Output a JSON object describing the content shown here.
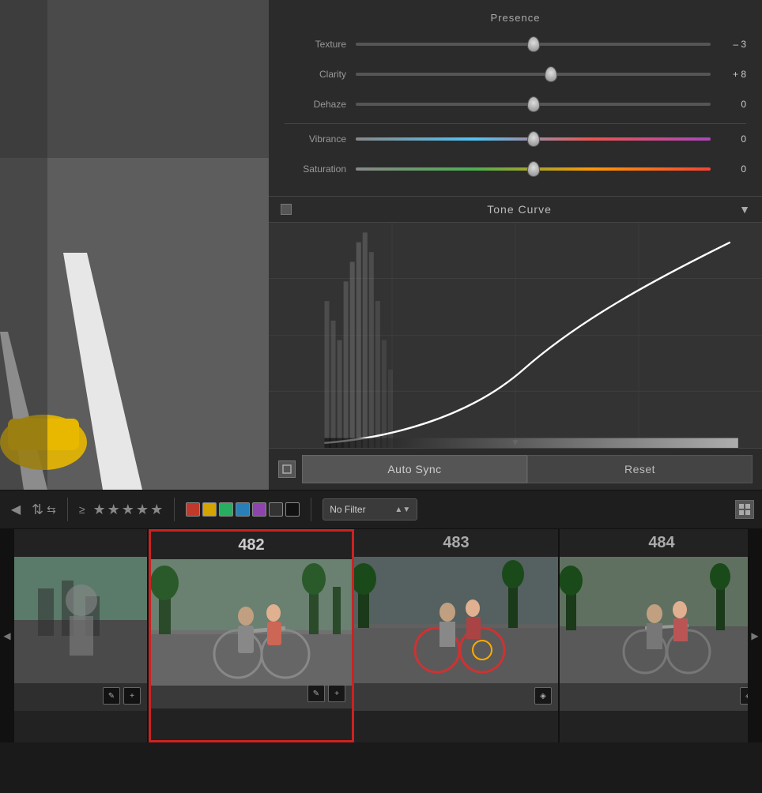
{
  "presence": {
    "title": "Presence",
    "sliders": [
      {
        "label": "Texture",
        "value": -3,
        "display": "– 3",
        "position": 0.5,
        "type": "normal"
      },
      {
        "label": "Clarity",
        "value": 8,
        "display": "+ 8",
        "position": 0.55,
        "type": "normal"
      },
      {
        "label": "Dehaze",
        "value": 0,
        "display": "0",
        "position": 0.5,
        "type": "normal"
      },
      {
        "label": "Vibrance",
        "value": 0,
        "display": "0",
        "position": 0.5,
        "type": "vibrance"
      },
      {
        "label": "Saturation",
        "value": 0,
        "display": "0",
        "position": 0.5,
        "type": "saturation"
      }
    ]
  },
  "tone_curve": {
    "title": "Tone Curve",
    "dropdown": "▼"
  },
  "buttons": {
    "auto_sync": "Auto Sync",
    "reset": "Reset"
  },
  "toolbar": {
    "no_filter": "No Filter"
  },
  "filmstrip": {
    "items": [
      {
        "number": "",
        "selected": false,
        "partial": true
      },
      {
        "number": "482",
        "selected": true,
        "partial": false
      },
      {
        "number": "483",
        "selected": false,
        "partial": false
      },
      {
        "number": "484",
        "selected": false,
        "partial": false
      }
    ]
  },
  "stars": [
    "★",
    "★",
    "★",
    "★",
    "★"
  ],
  "colors": {
    "red": "#e53935",
    "yellow": "#fdd835",
    "green": "#43a047",
    "blue": "#1e88e5",
    "purple": "#8e24aa",
    "dark": "#333333",
    "dark2": "#1a1a1a"
  }
}
